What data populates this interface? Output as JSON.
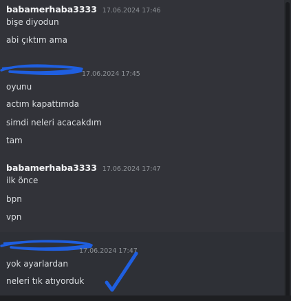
{
  "groups": [
    {
      "username": "babamerhaba3333",
      "timestamp": "17.06.2024 17:46",
      "messages": [
        "bişe diyodun",
        "abi çıktım ama"
      ]
    },
    {
      "username": "",
      "timestamp": "17.06.2024 17:45",
      "messages": [
        "oyunu",
        "actım kapattımda",
        "simdi neleri acacakdım",
        "tam"
      ]
    },
    {
      "username": "babamerhaba3333",
      "timestamp": "17.06.2024 17:47",
      "messages": [
        "ilk önce",
        "bpn",
        "vpn"
      ]
    },
    {
      "username": "",
      "timestamp": "17.06.2024 17:47",
      "messages": [
        "yok ayarlardan",
        "neleri tık atıyorduk"
      ]
    }
  ],
  "colors": {
    "background": "#323339",
    "scribble": "#1f5fe0",
    "text": "#dbdee1",
    "timestamp": "#8e9297"
  }
}
